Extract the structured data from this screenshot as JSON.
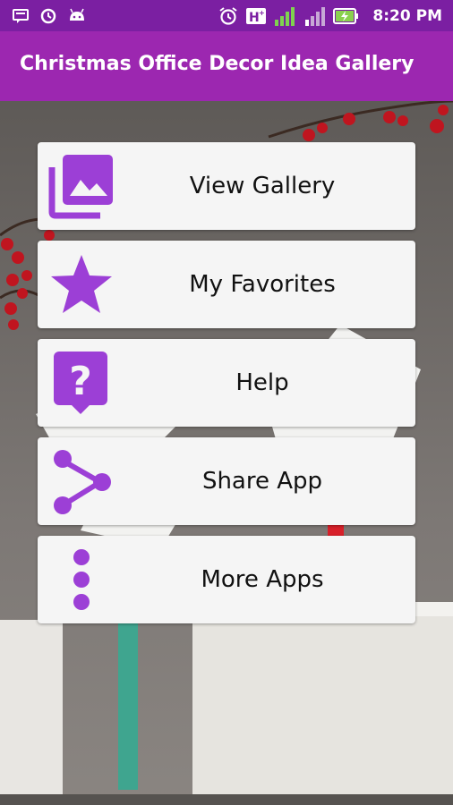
{
  "status_bar": {
    "time": "8:20 PM",
    "left_icons": [
      "notification-message-icon",
      "sync-icon",
      "android-icon"
    ],
    "right_icons": [
      "alarm-icon",
      "hplus-signal-icon",
      "signal-icon",
      "signal-weak-icon",
      "battery-charging-icon"
    ]
  },
  "app_bar": {
    "title": "Christmas Office Decor Idea Gallery"
  },
  "menu": {
    "items": [
      {
        "label": "View Gallery",
        "icon": "gallery-icon"
      },
      {
        "label": "My Favorites",
        "icon": "star-icon"
      },
      {
        "label": "Help",
        "icon": "help-icon"
      },
      {
        "label": "Share App",
        "icon": "share-icon"
      },
      {
        "label": "More Apps",
        "icon": "more-vertical-icon"
      }
    ]
  },
  "colors": {
    "status_bar": "#7b1fa2",
    "app_bar": "#9c27b0",
    "accent": "#9c3fd6",
    "card": "#f5f5f5"
  }
}
